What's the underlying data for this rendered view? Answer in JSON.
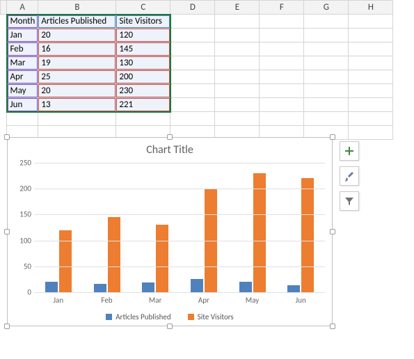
{
  "columns": [
    "A",
    "B",
    "C",
    "D",
    "E",
    "F",
    "G",
    "H"
  ],
  "headers": {
    "A": "Month",
    "B": "Articles Published",
    "C": "Site Visitors"
  },
  "rows": [
    {
      "month": "Jan",
      "articles": 20,
      "visitors": 120
    },
    {
      "month": "Feb",
      "articles": 16,
      "visitors": 145
    },
    {
      "month": "Mar",
      "articles": 19,
      "visitors": 130
    },
    {
      "month": "Apr",
      "articles": 25,
      "visitors": 200
    },
    {
      "month": "May",
      "articles": 20,
      "visitors": 230
    },
    {
      "month": "Jun",
      "articles": 13,
      "visitors": 221
    }
  ],
  "chart_data": {
    "type": "bar",
    "title": "Chart Title",
    "categories": [
      "Jan",
      "Feb",
      "Mar",
      "Apr",
      "May",
      "Jun"
    ],
    "series": [
      {
        "name": "Articles Published",
        "values": [
          20,
          16,
          19,
          25,
          20,
          13
        ],
        "color": "#4f81bd"
      },
      {
        "name": "Site Visitors",
        "values": [
          120,
          145,
          130,
          200,
          230,
          221
        ],
        "color": "#ed7d31"
      }
    ],
    "ylim": [
      0,
      250
    ],
    "yticks": [
      0,
      50,
      100,
      150,
      200,
      250
    ],
    "xlabel": "",
    "ylabel": ""
  },
  "chart_buttons": {
    "add": "Chart Elements",
    "style": "Chart Styles",
    "filter": "Chart Filters"
  }
}
